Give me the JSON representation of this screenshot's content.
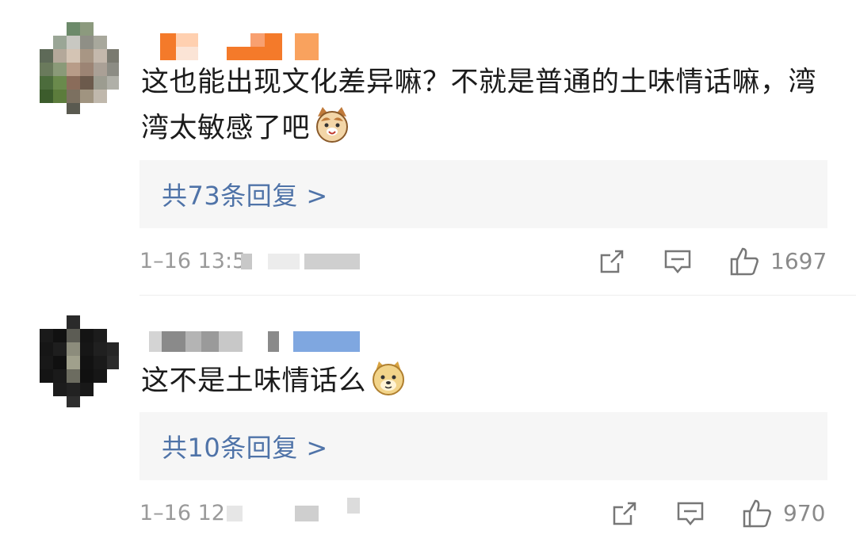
{
  "comments": [
    {
      "text": "这也能出现文化差异嘛？不就是普通的土味情话嘛，湾湾太敏感了吧",
      "emoji": "cat-face-emoji",
      "replies_label": "共73条回复 >",
      "time": "1–16 13:5",
      "likes": "1697",
      "name_color": "#f47a2a"
    },
    {
      "text": "这不是土味情话么",
      "emoji": "doge-emoji",
      "replies_label": "共10条回复 >",
      "time": "1–16 12",
      "likes": "970",
      "name_color": "#9a9a9a",
      "badge_color": "#7fa7e0"
    }
  ],
  "colors": {
    "link": "#4f73a8",
    "meta": "#9a9a9a",
    "reply_bg": "#f6f6f6"
  }
}
